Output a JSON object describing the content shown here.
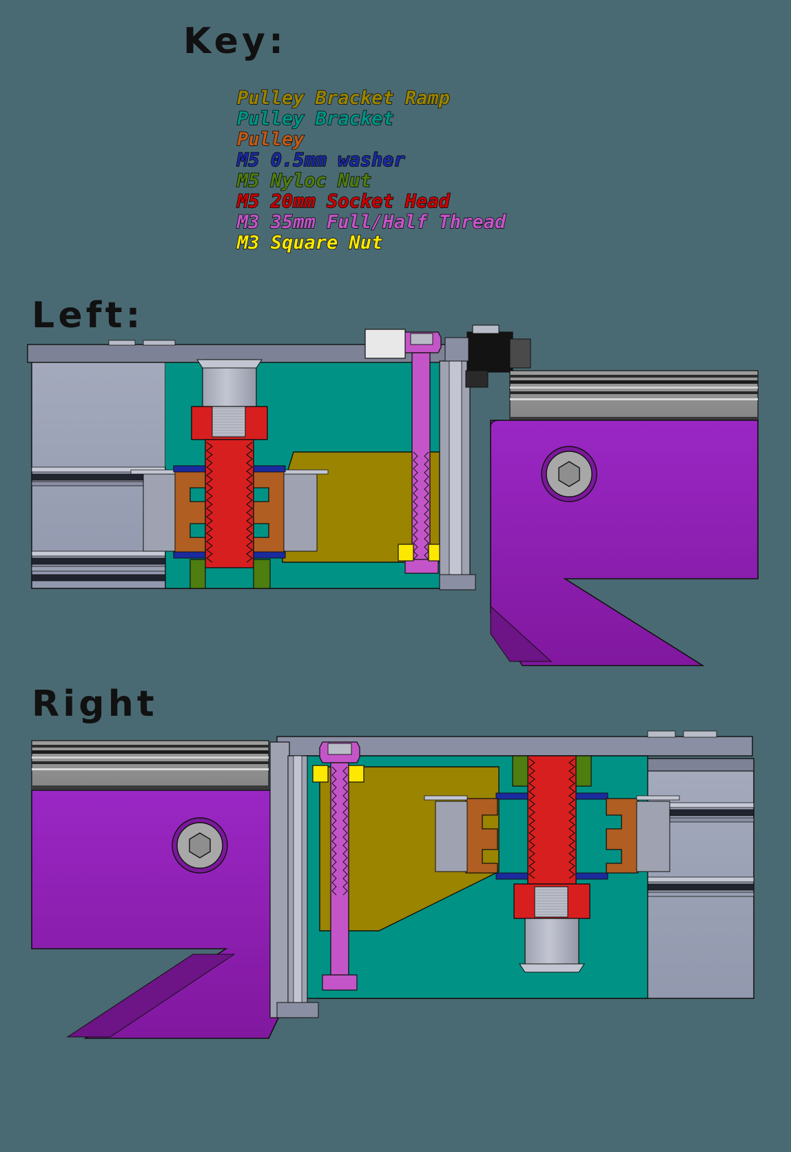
{
  "background_color": "#4a6a73",
  "key": {
    "title": "Key:",
    "items": [
      {
        "label": "Pulley Bracket Ramp",
        "color": "#9a8400"
      },
      {
        "label": "Pulley Bracket",
        "color": "#009385"
      },
      {
        "label": "Pulley",
        "color": "#c05a18"
      },
      {
        "label": "M5 0.5mm washer",
        "color": "#1b2a9e"
      },
      {
        "label": "M5 Nyloc Nut",
        "color": "#4e7d10"
      },
      {
        "label": "M5 20mm Socket Head",
        "color": "#c90000"
      },
      {
        "label": "M3 35mm Full/Half Thread",
        "color": "#c455c8"
      },
      {
        "label": "M3 Square Nut",
        "color": "#ffe800"
      }
    ]
  },
  "sections": [
    {
      "id": "left",
      "title": "Left:"
    },
    {
      "id": "right",
      "title": "Right"
    }
  ],
  "palette": {
    "extrusion_face": "#9aa0b4",
    "extrusion_top": "#7d8296",
    "extrusion_dark": "#20242e",
    "extrusion_light": "#c6cad7",
    "rail_grey": "#8e8e8e",
    "bracket_teal": "#009385",
    "ramp_olive": "#9a8400",
    "pulley_orange": "#b05e22",
    "washer_blue": "#1b2a9e",
    "nyloc_green": "#4e7d10",
    "bolt_red": "#d81f1f",
    "bolt_red_dark": "#b00000",
    "m3_magenta": "#c455c8",
    "square_nut_yellow": "#ffe800",
    "gantry_purple": "#8b1fb5",
    "steel_grey": "#a8aab8",
    "switch_black": "#131313",
    "outline": "#111111"
  },
  "assemblies": {
    "left": {
      "name": "left-pulley-assembly-section",
      "parts": [
        "aluminium-extrusion",
        "linear-rail",
        "pulley-bracket",
        "pulley-bracket-ramp",
        "pulley",
        "m5-socket-head-bolt",
        "m5-washer",
        "m5-nyloc-nut",
        "m3-screw",
        "m3-square-nut",
        "gantry-plate",
        "limit-switch",
        "hex-socket-screw"
      ]
    },
    "right": {
      "name": "right-pulley-assembly-section",
      "parts": [
        "aluminium-extrusion",
        "linear-rail",
        "pulley-bracket",
        "pulley-bracket-ramp",
        "pulley",
        "m5-socket-head-bolt",
        "m5-washer",
        "m5-nyloc-nut",
        "m3-screw",
        "m3-square-nut",
        "gantry-plate",
        "hex-socket-screw"
      ]
    }
  }
}
